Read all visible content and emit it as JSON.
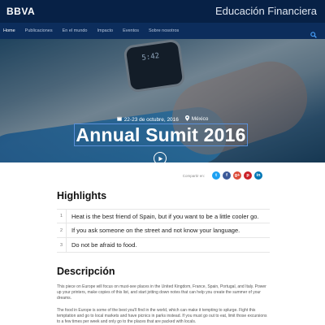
{
  "brand": {
    "logo": "BBVA",
    "title": "Educación Financiera"
  },
  "nav": {
    "items": [
      {
        "label": "Home",
        "active": true
      },
      {
        "label": "Publicaciones"
      },
      {
        "label": "En el mundo"
      },
      {
        "label": "Impacto"
      },
      {
        "label": "Eventos"
      },
      {
        "label": "Sobre nosotros"
      }
    ],
    "search_icon": "search-icon"
  },
  "hero": {
    "date": "22-23 de octubre, 2016",
    "place": "México",
    "title": "Annual Sumit 2016",
    "watch_time": "5:42",
    "play_icon": "play-icon"
  },
  "share": {
    "label": "Compartir en:",
    "networks": [
      {
        "name": "twitter",
        "glyph": "t",
        "color": "#1da1f2"
      },
      {
        "name": "facebook",
        "glyph": "f",
        "color": "#3b5998"
      },
      {
        "name": "google-plus",
        "glyph": "g+",
        "color": "#dd4b39"
      },
      {
        "name": "pinterest",
        "glyph": "p",
        "color": "#cb2027"
      },
      {
        "name": "linkedin",
        "glyph": "in",
        "color": "#0077b5"
      }
    ]
  },
  "highlights": {
    "title": "Highlights",
    "items": [
      {
        "num": "1",
        "text": "Heat is the best friend of Spain, but if you want to be a little cooler go."
      },
      {
        "num": "2",
        "text": "If you ask someone on the street and not know your language."
      },
      {
        "num": "3",
        "text": "Do not be afraid to food."
      }
    ]
  },
  "description": {
    "title": "Descripción",
    "paragraphs": [
      "This piece on Europe will focus on must-see places in the United Kingdom, France, Spain, Portugal, and Italy. Power up your printers, make copies of this list, and start jotting down notes that can help you create the summer of your dreams.",
      "The food in Europe is some of the best you'll find in the world, which can make it tempting to splurge. Fight this temptation and go to local markets and have picnics in parks instead. If you must go out to eat, limit those excursions to a few times per week and only go to the places that are packed with locals."
    ]
  }
}
